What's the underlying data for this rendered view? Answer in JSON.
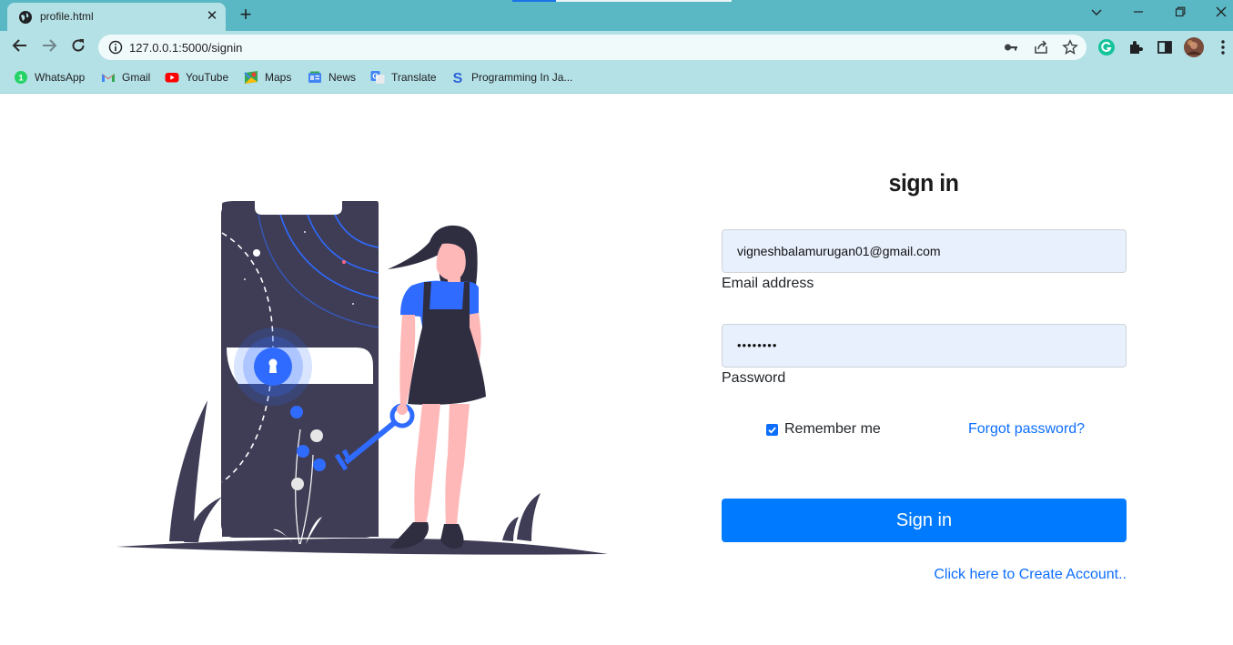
{
  "browser": {
    "tab_title": "profile.html",
    "url": "127.0.0.1:5000/signin",
    "bookmarks": [
      {
        "label": "WhatsApp",
        "icon": "whatsapp-icon"
      },
      {
        "label": "Gmail",
        "icon": "gmail-icon"
      },
      {
        "label": "YouTube",
        "icon": "youtube-icon"
      },
      {
        "label": "Maps",
        "icon": "maps-icon"
      },
      {
        "label": "News",
        "icon": "news-icon"
      },
      {
        "label": "Translate",
        "icon": "translate-icon"
      },
      {
        "label": "Programming In Ja...",
        "icon": "programming-s-icon"
      }
    ],
    "theme_color": "#5ab8c4",
    "toolbar_color": "#b4e1e6"
  },
  "form": {
    "heading": "sign in",
    "email_value": "vigneshbalamurugan01@gmail.com",
    "email_label": "Email address",
    "password_value": "••••••••",
    "password_label": "Password",
    "remember_label": "Remember me",
    "remember_checked": true,
    "forgot_label": "Forgot password?",
    "submit_label": "Sign in",
    "create_account_label": "Click here to Create Account..",
    "accent_color": "#007bff"
  }
}
